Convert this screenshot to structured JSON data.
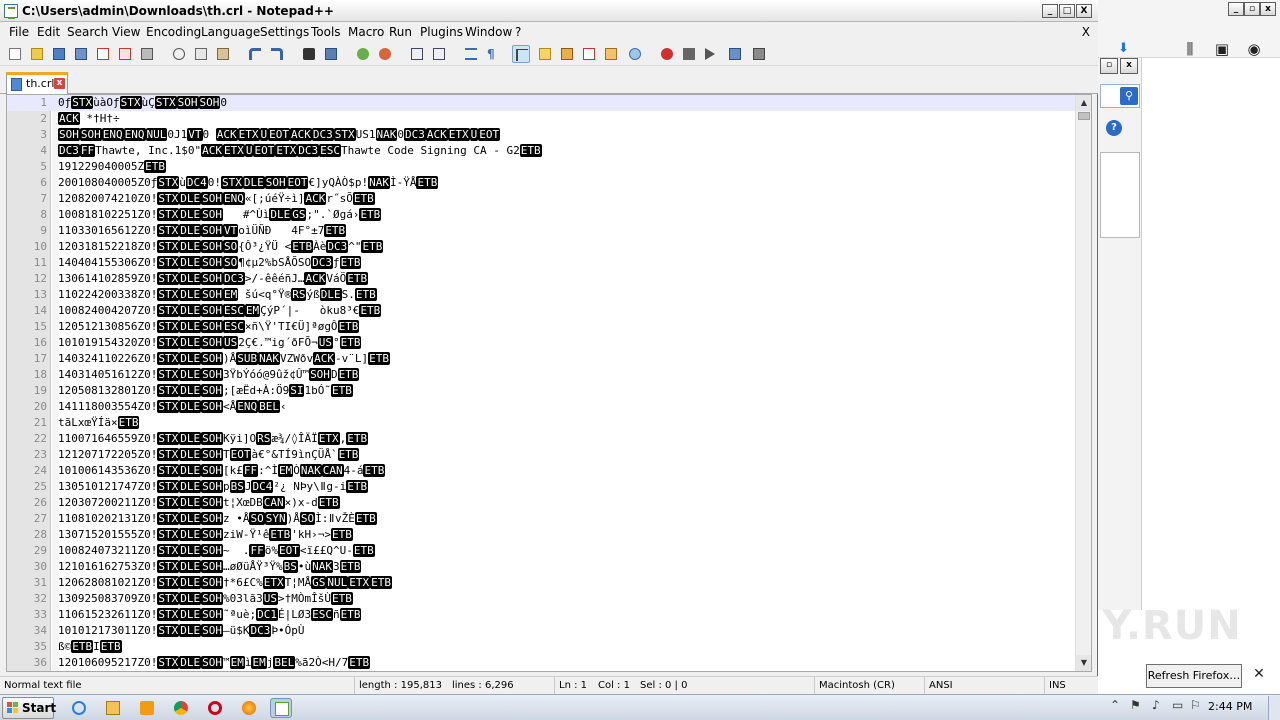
{
  "window": {
    "title": "C:\\Users\\admin\\Downloads\\th.crl - Notepad++",
    "minimize": "_",
    "maximize": "□",
    "close": "X"
  },
  "menu": {
    "items": [
      "File",
      "Edit",
      "Search",
      "View",
      "Encoding",
      "Language",
      "Settings",
      "Tools",
      "Macro",
      "Run",
      "Plugins",
      "Window",
      "?"
    ],
    "close": "X"
  },
  "toolbar": {
    "buttons": [
      "new-file",
      "open-file",
      "save",
      "save-all",
      "close",
      "close-all",
      "print",
      "cut",
      "copy",
      "paste",
      "undo",
      "redo",
      "find",
      "replace",
      "zoom-in",
      "zoom-out",
      "sync-vertical",
      "sync-horizontal",
      "word-wrap",
      "show-all-chars",
      "indent-guide",
      "user-defined-lang",
      "doc-map",
      "function-list",
      "folder-as-workspace",
      "monitoring",
      "record-macro",
      "stop-recording",
      "playback-macro",
      "run-macro-multiple",
      "save-macro"
    ]
  },
  "tab": {
    "label": "th.crl",
    "close": "x"
  },
  "editor": {
    "lines": [
      [
        [
          "t",
          "0ƒ"
        ],
        [
          "c",
          "STX"
        ],
        [
          "t",
          "ùàOƒ"
        ],
        [
          "c",
          "STX"
        ],
        [
          "t",
          "ùÇ"
        ],
        [
          "c",
          "STX"
        ],
        [
          "c",
          "SOH"
        ],
        [
          "c",
          "SOH"
        ],
        [
          "t",
          "0"
        ]
      ],
      [
        [
          "c",
          "ACK"
        ],
        [
          "t",
          " *†H†÷"
        ]
      ],
      [
        [
          "c",
          "SOH"
        ],
        [
          "c",
          "SOH"
        ],
        [
          "c",
          "ENQ"
        ],
        [
          "c",
          "ENQ"
        ],
        [
          "c",
          "NUL"
        ],
        [
          "t",
          "0J1"
        ],
        [
          "c",
          "VT"
        ],
        [
          "t",
          "0 "
        ],
        [
          "c",
          "ACK"
        ],
        [
          "c",
          "ETX"
        ],
        [
          "c",
          "U"
        ],
        [
          "c",
          "EOT"
        ],
        [
          "c",
          "ACK"
        ],
        [
          "c",
          "DC3"
        ],
        [
          "c",
          "STX"
        ],
        [
          "t",
          "US1"
        ],
        [
          "c",
          "NAK"
        ],
        [
          "t",
          "0"
        ],
        [
          "c",
          "DC3"
        ],
        [
          "c",
          "ACK"
        ],
        [
          "c",
          "ETX"
        ],
        [
          "c",
          "U"
        ],
        [
          "c",
          "EOT"
        ]
      ],
      [
        [
          "c",
          "DC3"
        ],
        [
          "c",
          "FF"
        ],
        [
          "t",
          "Thawte, Inc.1$0\""
        ],
        [
          "c",
          "ACK"
        ],
        [
          "c",
          "ETX"
        ],
        [
          "c",
          "U"
        ],
        [
          "c",
          "EOT"
        ],
        [
          "c",
          "ETX"
        ],
        [
          "c",
          "DC3"
        ],
        [
          "c",
          "ESC"
        ],
        [
          "t",
          "Thawte Code Signing CA - G2"
        ],
        [
          "c",
          "ETB"
        ]
      ],
      [
        [
          "t",
          "191229040005Z"
        ],
        [
          "c",
          "ETB"
        ]
      ],
      [
        [
          "t",
          "200108040005Z0ƒ"
        ],
        [
          "c",
          "STX"
        ],
        [
          "t",
          "ù"
        ],
        [
          "c",
          "DC4"
        ],
        [
          "t",
          "0!"
        ],
        [
          "c",
          "STX"
        ],
        [
          "c",
          "DLE"
        ],
        [
          "c",
          "SOH"
        ],
        [
          "c",
          "EOT"
        ],
        [
          "t",
          "€]yQÀÒ$p!"
        ],
        [
          "c",
          "NAK"
        ],
        [
          "t",
          "Ì-ŸÅ"
        ],
        [
          "c",
          "ETB"
        ]
      ],
      [
        [
          "t",
          "120820074210Z0!"
        ],
        [
          "c",
          "STX"
        ],
        [
          "c",
          "DLE"
        ],
        [
          "c",
          "SOH"
        ],
        [
          "c",
          "ENQ"
        ],
        [
          "t",
          "«[;úéŸ÷ì]"
        ],
        [
          "c",
          "ACK"
        ],
        [
          "t",
          "r˝sÕ"
        ],
        [
          "c",
          "ETB"
        ]
      ],
      [
        [
          "t",
          "100818102251Z0!"
        ],
        [
          "c",
          "STX"
        ],
        [
          "c",
          "DLE"
        ],
        [
          "c",
          "SOH"
        ],
        [
          "t",
          "   #^Ùì"
        ],
        [
          "c",
          "DLE"
        ],
        [
          "c",
          "GS"
        ],
        [
          "t",
          ";\".`Øgá›"
        ],
        [
          "c",
          "ETB"
        ]
      ],
      [
        [
          "t",
          "110330165612Z0!"
        ],
        [
          "c",
          "STX"
        ],
        [
          "c",
          "DLE"
        ],
        [
          "c",
          "SOH"
        ],
        [
          "c",
          "VT"
        ],
        [
          "t",
          "oìÜÑÐ   4F°±7"
        ],
        [
          "c",
          "ETB"
        ]
      ],
      [
        [
          "t",
          "120318152218Z0!"
        ],
        [
          "c",
          "STX"
        ],
        [
          "c",
          "DLE"
        ],
        [
          "c",
          "SOH"
        ],
        [
          "c",
          "SO"
        ],
        [
          "t",
          "{Ô³¿ŸÜ <"
        ],
        [
          "c",
          "ETB"
        ],
        [
          "t",
          "Àè"
        ],
        [
          "c",
          "DC3"
        ],
        [
          "t",
          "^\""
        ],
        [
          "c",
          "ETB"
        ]
      ],
      [
        [
          "t",
          "140404155306Z0!"
        ],
        [
          "c",
          "STX"
        ],
        [
          "c",
          "DLE"
        ],
        [
          "c",
          "SOH"
        ],
        [
          "c",
          "SO"
        ],
        [
          "t",
          "¶¢µ2%bSÅÕSO"
        ],
        [
          "c",
          "DC3"
        ],
        [
          "t",
          "ƒ"
        ],
        [
          "c",
          "ETB"
        ]
      ],
      [
        [
          "t",
          "130614102859Z0!"
        ],
        [
          "c",
          "STX"
        ],
        [
          "c",
          "DLE"
        ],
        [
          "c",
          "SOH"
        ],
        [
          "c",
          "DC3"
        ],
        [
          "t",
          ">/-êêéñJ…"
        ],
        [
          "c",
          "ACK"
        ],
        [
          "t",
          "VáÖ"
        ],
        [
          "c",
          "ETB"
        ]
      ],
      [
        [
          "t",
          "110224200338Z0!"
        ],
        [
          "c",
          "STX"
        ],
        [
          "c",
          "DLE"
        ],
        [
          "c",
          "SOH"
        ],
        [
          "c",
          "EM"
        ],
        [
          "t",
          " šú<q°Ÿ®"
        ],
        [
          "c",
          "RS"
        ],
        [
          "t",
          "ýß"
        ],
        [
          "c",
          "DLE"
        ],
        [
          "t",
          "S."
        ],
        [
          "c",
          "ETB"
        ]
      ],
      [
        [
          "t",
          "100824004207Z0!"
        ],
        [
          "c",
          "STX"
        ],
        [
          "c",
          "DLE"
        ],
        [
          "c",
          "SOH"
        ],
        [
          "c",
          "ESC"
        ],
        [
          "c",
          "EM"
        ],
        [
          "t",
          "ÇýP´|-   òku8³€"
        ],
        [
          "c",
          "ETB"
        ]
      ],
      [
        [
          "t",
          "120512130856Z0!"
        ],
        [
          "c",
          "STX"
        ],
        [
          "c",
          "DLE"
        ],
        [
          "c",
          "SOH"
        ],
        [
          "c",
          "ESC"
        ],
        [
          "t",
          "×ñ\\Ÿ'TI€Ü]ªøgÔ"
        ],
        [
          "c",
          "ETB"
        ]
      ],
      [
        [
          "t",
          "101019154320Z0!"
        ],
        [
          "c",
          "STX"
        ],
        [
          "c",
          "DLE"
        ],
        [
          "c",
          "SOH"
        ],
        [
          "c",
          "US"
        ],
        [
          "t",
          "2Ç€.™ig´ðFÕ¬"
        ],
        [
          "c",
          "US"
        ],
        [
          "t",
          "°"
        ],
        [
          "c",
          "ETB"
        ]
      ],
      [
        [
          "t",
          "140324110226Z0!"
        ],
        [
          "c",
          "STX"
        ],
        [
          "c",
          "DLE"
        ],
        [
          "c",
          "SOH"
        ],
        [
          "t",
          ")Å"
        ],
        [
          "c",
          "SUB"
        ],
        [
          "c",
          "NAK"
        ],
        [
          "t",
          "VZWðv"
        ],
        [
          "c",
          "ACK"
        ],
        [
          "t",
          "-v¨L]"
        ],
        [
          "c",
          "ETB"
        ]
      ],
      [
        [
          "t",
          "140314051612Z0!"
        ],
        [
          "c",
          "STX"
        ],
        [
          "c",
          "DLE"
        ],
        [
          "c",
          "SOH"
        ],
        [
          "t",
          "3ŸbÝóó@9ûž¢Û™"
        ],
        [
          "c",
          "SOH"
        ],
        [
          "t",
          "D"
        ],
        [
          "c",
          "ETB"
        ]
      ],
      [
        [
          "t",
          "120508132801Z0!"
        ],
        [
          "c",
          "STX"
        ],
        [
          "c",
          "DLE"
        ],
        [
          "c",
          "SOH"
        ],
        [
          "t",
          ";[æËd+À:Ö9"
        ],
        [
          "c",
          "SI"
        ],
        [
          "t",
          "1bÓ˜"
        ],
        [
          "c",
          "ETB"
        ]
      ],
      [
        [
          "t",
          "141118003554Z0!"
        ],
        [
          "c",
          "STX"
        ],
        [
          "c",
          "DLE"
        ],
        [
          "c",
          "SOH"
        ],
        [
          "t",
          "<Å"
        ],
        [
          "c",
          "ENQ"
        ],
        [
          "c",
          "BEL"
        ],
        [
          "t",
          "‹"
        ]
      ],
      [
        [
          "t",
          "tãLxœŸÍä×"
        ],
        [
          "c",
          "ETB"
        ]
      ],
      [
        [
          "t",
          "110071646559Z0!"
        ],
        [
          "c",
          "STX"
        ],
        [
          "c",
          "DLE"
        ],
        [
          "c",
          "SOH"
        ],
        [
          "t",
          "Kÿi]O"
        ],
        [
          "c",
          "RS"
        ],
        [
          "t",
          "æ¾/◊ÎÄÏ"
        ],
        [
          "c",
          "ETX"
        ],
        [
          "t",
          ","
        ],
        [
          "c",
          "ETB"
        ]
      ],
      [
        [
          "t",
          "121207172205Z0!"
        ],
        [
          "c",
          "STX"
        ],
        [
          "c",
          "DLE"
        ],
        [
          "c",
          "SOH"
        ],
        [
          "t",
          "T"
        ],
        [
          "c",
          "EOT"
        ],
        [
          "t",
          "à€°&TÍ9ìnÇÜÅ`"
        ],
        [
          "c",
          "ETB"
        ]
      ],
      [
        [
          "t",
          "101006143536Z0!"
        ],
        [
          "c",
          "STX"
        ],
        [
          "c",
          "DLE"
        ],
        [
          "c",
          "SOH"
        ],
        [
          "t",
          "[k£"
        ],
        [
          "c",
          "FF"
        ],
        [
          "t",
          ":^Ì"
        ],
        [
          "c",
          "EM"
        ],
        [
          "t",
          "Ò"
        ],
        [
          "c",
          "NAK"
        ],
        [
          "c",
          "CAN"
        ],
        [
          "t",
          "4-á"
        ],
        [
          "c",
          "ETB"
        ]
      ],
      [
        [
          "t",
          "130510121747Z0!"
        ],
        [
          "c",
          "STX"
        ],
        [
          "c",
          "DLE"
        ],
        [
          "c",
          "SOH"
        ],
        [
          "t",
          "p"
        ],
        [
          "c",
          "BS"
        ],
        [
          "t",
          "J"
        ],
        [
          "c",
          "DC4"
        ],
        [
          "t",
          "²¿ NÞy\\ǁg-i"
        ],
        [
          "c",
          "ETB"
        ]
      ],
      [
        [
          "t",
          "120307200211Z0!"
        ],
        [
          "c",
          "STX"
        ],
        [
          "c",
          "DLE"
        ],
        [
          "c",
          "SOH"
        ],
        [
          "t",
          "t¦XœDB"
        ],
        [
          "c",
          "CAN"
        ],
        [
          "t",
          "×)x-d"
        ],
        [
          "c",
          "ETB"
        ]
      ],
      [
        [
          "t",
          "110810202131Z0!"
        ],
        [
          "c",
          "STX"
        ],
        [
          "c",
          "DLE"
        ],
        [
          "c",
          "SOH"
        ],
        [
          "t",
          "z •Å"
        ],
        [
          "c",
          "SO"
        ],
        [
          "c",
          "SYN"
        ],
        [
          "t",
          ")Å"
        ],
        [
          "c",
          "SO"
        ],
        [
          "t",
          "Ì:ǁvŽÈ"
        ],
        [
          "c",
          "ETB"
        ]
      ],
      [
        [
          "t",
          "130715201555Z0!"
        ],
        [
          "c",
          "STX"
        ],
        [
          "c",
          "DLE"
        ],
        [
          "c",
          "SOH"
        ],
        [
          "t",
          "ziW-Ÿ¹ê"
        ],
        [
          "c",
          "ETB"
        ],
        [
          "t",
          "'kH›¬>"
        ],
        [
          "c",
          "ETB"
        ]
      ],
      [
        [
          "t",
          "100824073211Z0!"
        ],
        [
          "c",
          "STX"
        ],
        [
          "c",
          "DLE"
        ],
        [
          "c",
          "SOH"
        ],
        [
          "t",
          "~  ."
        ],
        [
          "c",
          "FF"
        ],
        [
          "t",
          "ö%"
        ],
        [
          "c",
          "EOT"
        ],
        [
          "t",
          "<ï££Q^U-"
        ],
        [
          "c",
          "ETB"
        ]
      ],
      [
        [
          "t",
          "121016162753Z0!"
        ],
        [
          "c",
          "STX"
        ],
        [
          "c",
          "DLE"
        ],
        [
          "c",
          "SOH"
        ],
        [
          "t",
          "…øØüÅŸ³Ÿ%"
        ],
        [
          "c",
          "BS"
        ],
        [
          "t",
          "•ù"
        ],
        [
          "c",
          "NAK"
        ],
        [
          "t",
          "3"
        ],
        [
          "c",
          "ETB"
        ]
      ],
      [
        [
          "t",
          "120628081021Z0!"
        ],
        [
          "c",
          "STX"
        ],
        [
          "c",
          "DLE"
        ],
        [
          "c",
          "SOH"
        ],
        [
          "t",
          "†*6£C%"
        ],
        [
          "c",
          "ETX"
        ],
        [
          "t",
          "T¦MÅ"
        ],
        [
          "c",
          "GS"
        ],
        [
          "c",
          "NUL"
        ],
        [
          "c",
          "ETX"
        ],
        [
          "c",
          "ETB"
        ]
      ],
      [
        [
          "t",
          "130925083709Z0!"
        ],
        [
          "c",
          "STX"
        ],
        [
          "c",
          "DLE"
        ],
        [
          "c",
          "SOH"
        ],
        [
          "t",
          "%03lã3"
        ],
        [
          "c",
          "US"
        ],
        [
          "t",
          ">†MÒmÎšÙ"
        ],
        [
          "c",
          "ETB"
        ]
      ],
      [
        [
          "t",
          "110615232611Z0!"
        ],
        [
          "c",
          "STX"
        ],
        [
          "c",
          "DLE"
        ],
        [
          "c",
          "SOH"
        ],
        [
          "t",
          "˜ªuè;"
        ],
        [
          "c",
          "DC1"
        ],
        [
          "t",
          "É|LØ3"
        ],
        [
          "c",
          "ESC"
        ],
        [
          "t",
          "ñ"
        ],
        [
          "c",
          "ETB"
        ]
      ],
      [
        [
          "t",
          "101012173011Z0!"
        ],
        [
          "c",
          "STX"
        ],
        [
          "c",
          "DLE"
        ],
        [
          "c",
          "SOH"
        ],
        [
          "t",
          "—ü$K"
        ],
        [
          "c",
          "DC3"
        ],
        [
          "t",
          "Þ•ÓpÙ"
        ]
      ],
      [
        [
          "t",
          "ß©"
        ],
        [
          "c",
          "ETB"
        ],
        [
          "t",
          "I"
        ],
        [
          "c",
          "ETB"
        ]
      ],
      [
        [
          "t",
          "120106095217Z0!"
        ],
        [
          "c",
          "STX"
        ],
        [
          "c",
          "DLE"
        ],
        [
          "c",
          "SOH"
        ],
        [
          "t",
          "™"
        ],
        [
          "c",
          "EM"
        ],
        [
          "t",
          "ì"
        ],
        [
          "c",
          "EM"
        ],
        [
          "t",
          "j"
        ],
        [
          "c",
          "BEL"
        ],
        [
          "t",
          "%ã2Ò<H/7"
        ],
        [
          "c",
          "ETB"
        ]
      ]
    ]
  },
  "status": {
    "type": "Normal text file",
    "length": "length : 195,813",
    "lines": "lines : 6,296",
    "ln": "Ln : 1",
    "col": "Col : 1",
    "sel": "Sel : 0 | 0",
    "eol": "Macintosh (CR)",
    "encoding": "ANSI",
    "mode": "INS"
  },
  "firefox": {
    "refresh_button": "Refresh Firefox…",
    "close": "✕",
    "watermark": "ANY.RUN"
  },
  "taskbar": {
    "start_label": "Start",
    "clock": "2:44 PM",
    "apps": [
      "ie",
      "explorer",
      "media-player",
      "chrome",
      "opera",
      "firefox",
      "notepadpp"
    ]
  },
  "colors": {
    "control_char_bg": "#000000",
    "current_line": "#e8e8ff",
    "gutter": "#e4e4e4",
    "tab_accent": "#f5a623"
  }
}
